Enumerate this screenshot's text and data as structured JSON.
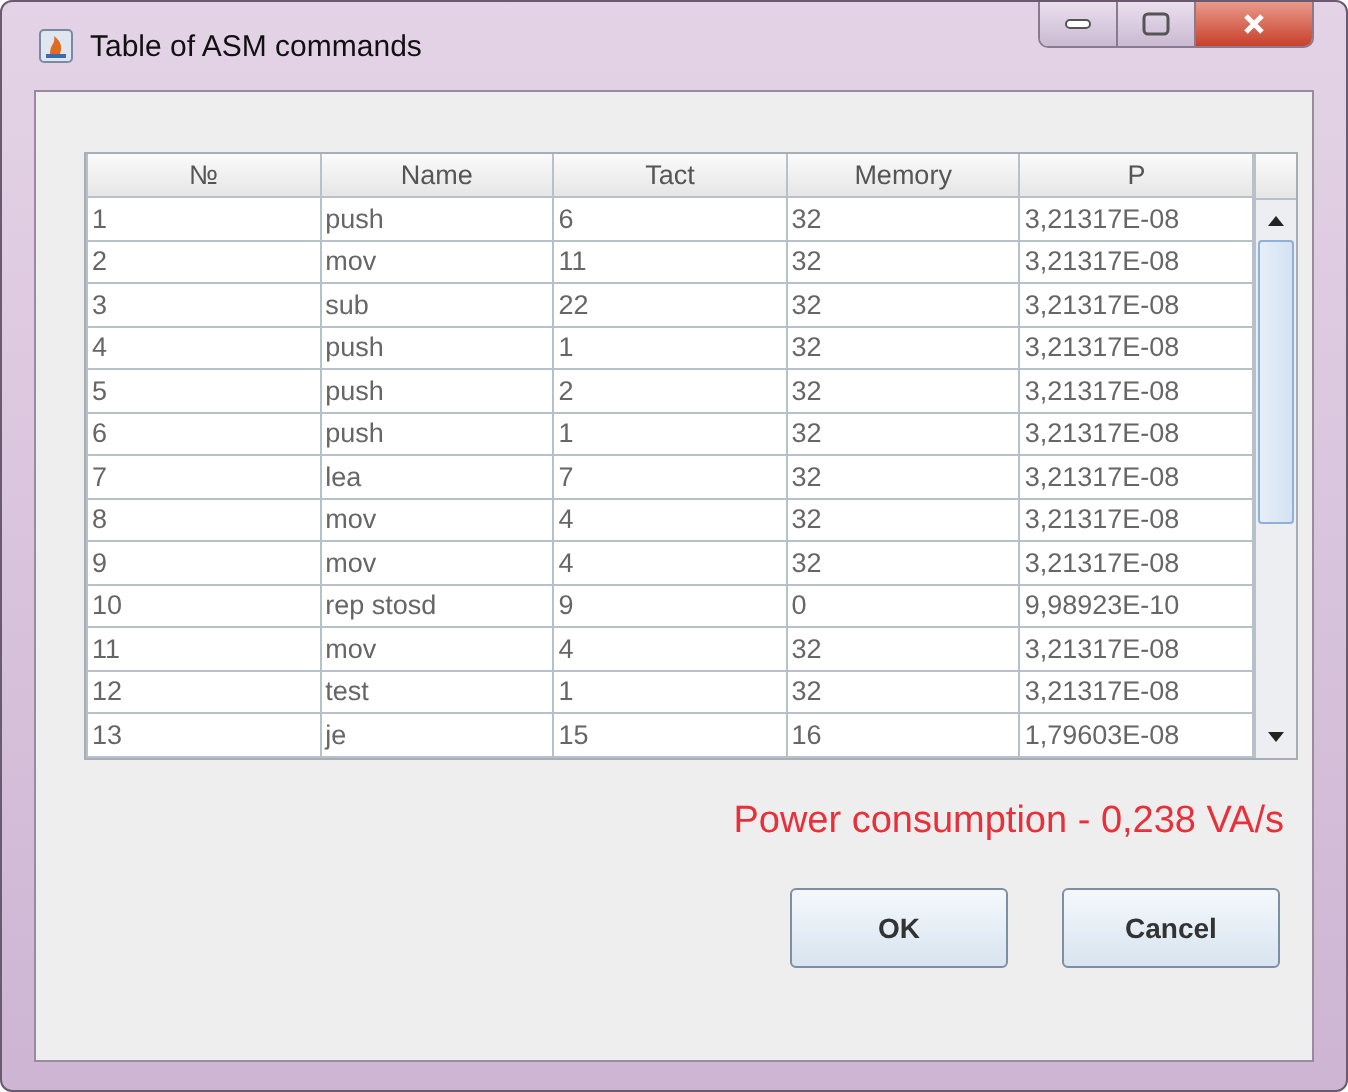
{
  "window": {
    "title": "Table of ASM commands"
  },
  "table": {
    "columns": [
      "№",
      "Name",
      "Tact",
      "Memory",
      "P"
    ],
    "rows": [
      [
        "1",
        "push",
        "6",
        "32",
        "3,21317E-08"
      ],
      [
        "2",
        "mov",
        "11",
        "32",
        "3,21317E-08"
      ],
      [
        "3",
        "sub",
        "22",
        "32",
        "3,21317E-08"
      ],
      [
        "4",
        "push",
        "1",
        "32",
        "3,21317E-08"
      ],
      [
        "5",
        "push",
        "2",
        "32",
        "3,21317E-08"
      ],
      [
        "6",
        "push",
        "1",
        "32",
        "3,21317E-08"
      ],
      [
        "7",
        "lea",
        "7",
        "32",
        "3,21317E-08"
      ],
      [
        "8",
        "mov",
        "4",
        "32",
        "3,21317E-08"
      ],
      [
        "9",
        "mov",
        "4",
        "32",
        "3,21317E-08"
      ],
      [
        "10",
        "rep stosd",
        "9",
        "0",
        "9,98923E-10"
      ],
      [
        "11",
        "mov",
        "4",
        "32",
        "3,21317E-08"
      ],
      [
        "12",
        "test",
        "1",
        "32",
        "3,21317E-08"
      ],
      [
        "13",
        "je",
        "15",
        "16",
        "1,79603E-08"
      ]
    ]
  },
  "result": "Power consumption - 0,238 VA/s",
  "buttons": [
    "OK",
    "Cancel"
  ]
}
